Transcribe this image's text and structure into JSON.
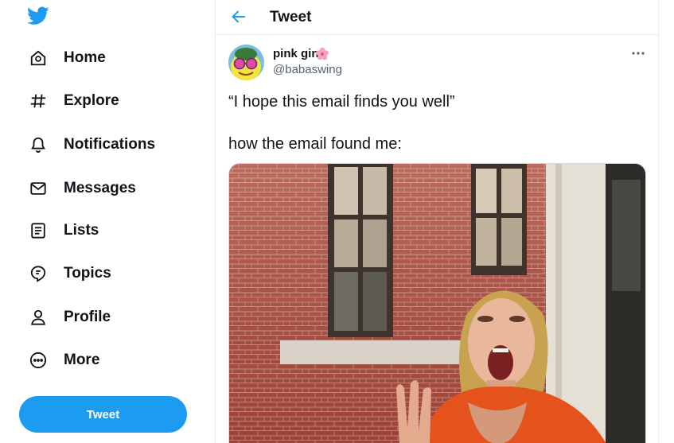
{
  "sidebar": {
    "items": [
      {
        "label": "Home",
        "icon": "home-icon"
      },
      {
        "label": "Explore",
        "icon": "hashtag-icon"
      },
      {
        "label": "Notifications",
        "icon": "bell-icon"
      },
      {
        "label": "Messages",
        "icon": "envelope-icon"
      },
      {
        "label": "Lists",
        "icon": "list-icon"
      },
      {
        "label": "Topics",
        "icon": "topics-icon"
      },
      {
        "label": "Profile",
        "icon": "person-icon"
      },
      {
        "label": "More",
        "icon": "more-circle-icon"
      }
    ],
    "tweet_button": "Tweet"
  },
  "header": {
    "title": "Tweet"
  },
  "tweet": {
    "display_name": "pink gin",
    "handle": "@babaswing",
    "text_line1": "“I hope this email finds you well”",
    "text_line2": "how the email found me:"
  },
  "colors": {
    "accent": "#1d9bf0",
    "text": "#0f1419",
    "muted": "#536471",
    "border": "#e6ecf0"
  }
}
